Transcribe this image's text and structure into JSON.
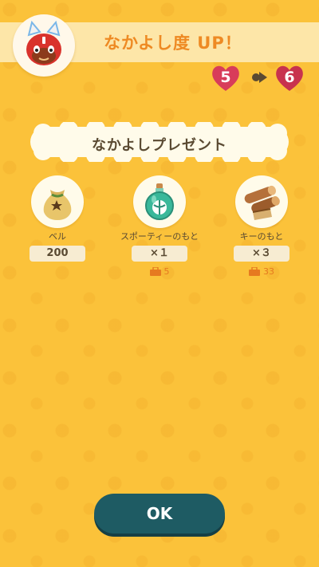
{
  "header": {
    "title": "なかよし度 UP！",
    "avatar_icon": "cat-villager-icon"
  },
  "friendship": {
    "from": "5",
    "to": "6",
    "heart_color": "#d83c5a",
    "arrow_icon": "arrow-right-icon"
  },
  "present_label": "なかよしプレゼント",
  "rewards": [
    {
      "name": "ベル",
      "qty": "200",
      "icon": "bell-bag-icon"
    },
    {
      "name": "スポーティーのもと",
      "qty": "×１",
      "bag_count": "5",
      "icon": "sporty-essence-bottle-icon"
    },
    {
      "name": "キーのもと",
      "qty": "×３",
      "bag_count": "33",
      "icon": "wood-logs-icon"
    }
  ],
  "ok_button": {
    "label": "OK",
    "color": "#1e5b63"
  },
  "colors": {
    "background": "#fbc23a",
    "title": "#ee8a23",
    "bag": "#e67a20"
  }
}
